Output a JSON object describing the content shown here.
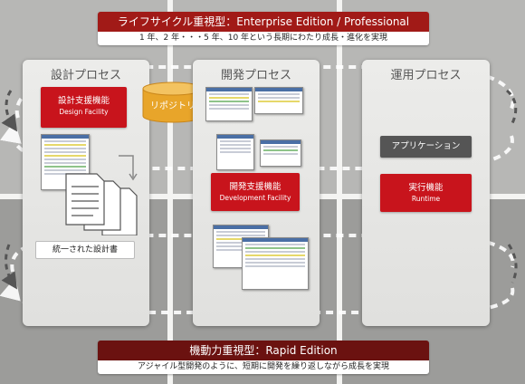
{
  "banner_top": {
    "title": "ライフサイクル重視型：Enterprise Edition / Professional Edition",
    "subtitle": "1 年、2 年・・・5 年、10 年という長期にわたり成長・進化を実現"
  },
  "banner_bottom": {
    "title": "機動力重視型：Rapid Edition",
    "subtitle": "アジャイル型開発のように、短期に開発を繰り返しながら成長を実現"
  },
  "panels": {
    "design": {
      "title": "設計プロセス",
      "facility_jp": "設計支援機能",
      "facility_en": "Design Facility",
      "doc_label": "統一された設計書"
    },
    "dev": {
      "title": "開発プロセス",
      "facility_jp": "開発支援機能",
      "facility_en": "Development Facility"
    },
    "ops": {
      "title": "運用プロセス",
      "application": "アプリケーション",
      "runtime_jp": "実行機能",
      "runtime_en": "Runtime"
    }
  },
  "repository": {
    "label": "リポジトリ"
  },
  "colors": {
    "brand_red": "#c8141c",
    "banner_top": "#a11a17",
    "banner_bottom": "#6b1210",
    "repository_gold": "#e8a52a",
    "application_grey": "#555555"
  }
}
